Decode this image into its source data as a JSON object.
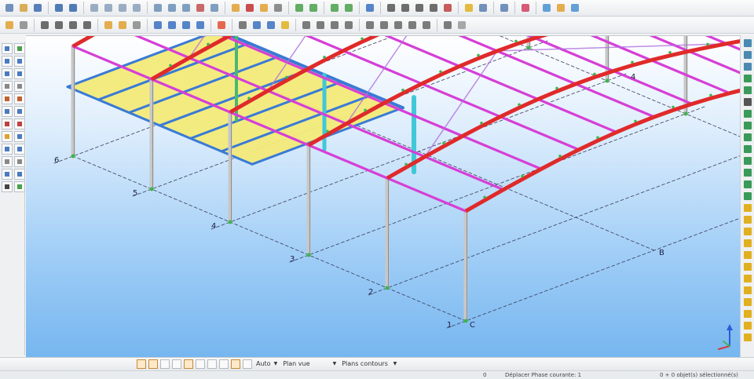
{
  "toolbar": {
    "row1_icons": [
      "new-icon",
      "open-icon",
      "save-icon",
      "undo-icon",
      "redo-icon",
      "copy-icon",
      "paste-icon",
      "print-icon",
      "view-icon",
      "cut-icon",
      "calc-icon",
      "layers-icon",
      "select-icon",
      "measure-icon",
      "filter-icon",
      "snap-icon"
    ],
    "row2_icons": [
      "section-icon",
      "beam-icon",
      "column-icon",
      "plate-icon",
      "support-icon",
      "load-icon",
      "mesh-icon",
      "result-icon"
    ]
  },
  "bottom": {
    "zoom_mode": "Auto",
    "view_mode": "Plan vue",
    "contours_mode": "Plans contours"
  },
  "status": {
    "left_value": "0",
    "phase_text": "Déplacer  Phase courante: 1",
    "selection_text": "0 + 0 objet(s) sélectionné(s)"
  },
  "viewport": {
    "grid_numbers": [
      "1",
      "2",
      "3",
      "4",
      "5",
      "6"
    ],
    "grid_letters": [
      "A",
      "B",
      "C"
    ],
    "model_numbers": [
      "4",
      "5",
      "6"
    ],
    "axis_label": "A",
    "colors": {
      "rafter": "#e02a2a",
      "purlin": "#d63fd6",
      "bracing": "#b070e0",
      "column": "#c8c8c8",
      "floor": "#f4eb7a",
      "floor_beam": "#3a7ad6",
      "support": "#3fb54a"
    }
  }
}
